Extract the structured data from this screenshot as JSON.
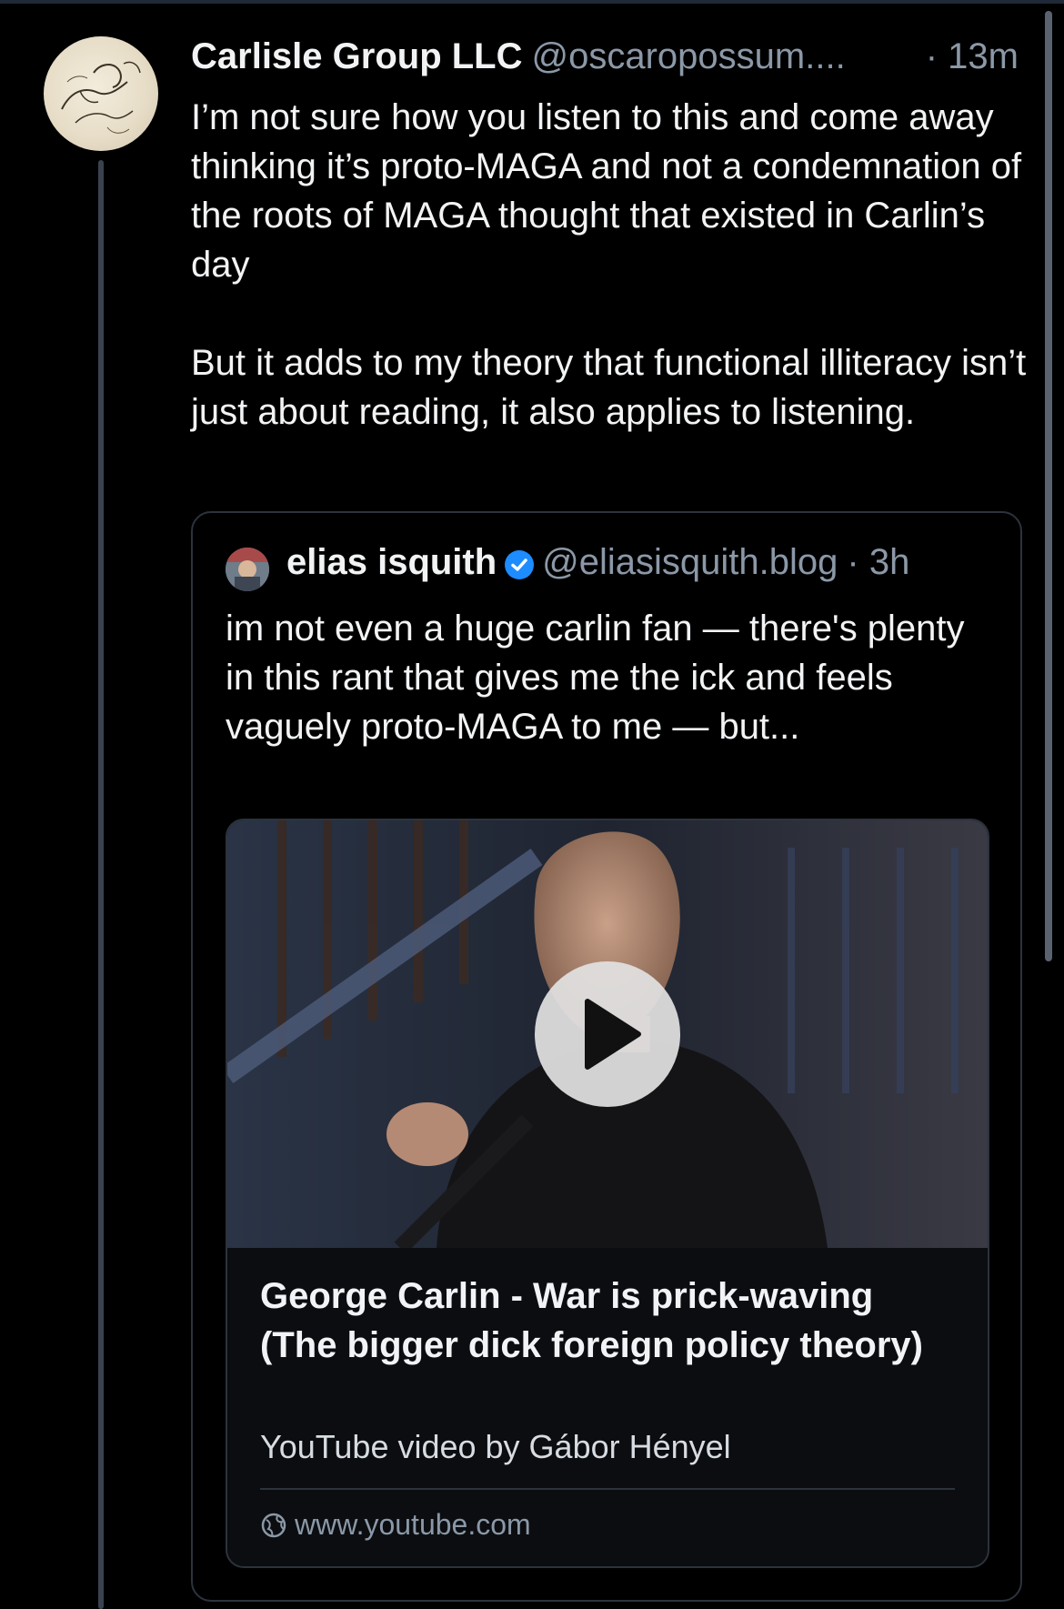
{
  "post": {
    "display_name": "Carlisle Group LLC",
    "handle": "@oscaropossum....",
    "time": "· 13m",
    "text": "I’m not sure how you listen to this and come away thinking it’s proto-MAGA and not a condemnation of the roots of MAGA thought that existed in Carlin’s day\n\nBut it adds to my theory that functional illiteracy isn’t just about reading, it also applies to listening."
  },
  "quote": {
    "display_name": "elias isquith",
    "handle": "@eliasisquith.blog",
    "time": "· 3h",
    "text": "im not even a huge carlin fan — there's plenty in this rant that gives me the ick and feels vaguely proto-MAGA to me — but..."
  },
  "embed": {
    "title": "George Carlin - War is prick-waving (The bigger dick foreign policy theory)",
    "description": "YouTube video by Gábor Hényel",
    "domain": "www.youtube.com"
  },
  "colors": {
    "background": "#000000",
    "text_primary": "#f1f3f5",
    "text_secondary": "#8b98a7",
    "verified_badge": "#1d8cff",
    "border": "#2c333d"
  },
  "icons": {
    "verified": "verified-check-icon",
    "play": "play-icon",
    "globe": "globe-icon"
  }
}
